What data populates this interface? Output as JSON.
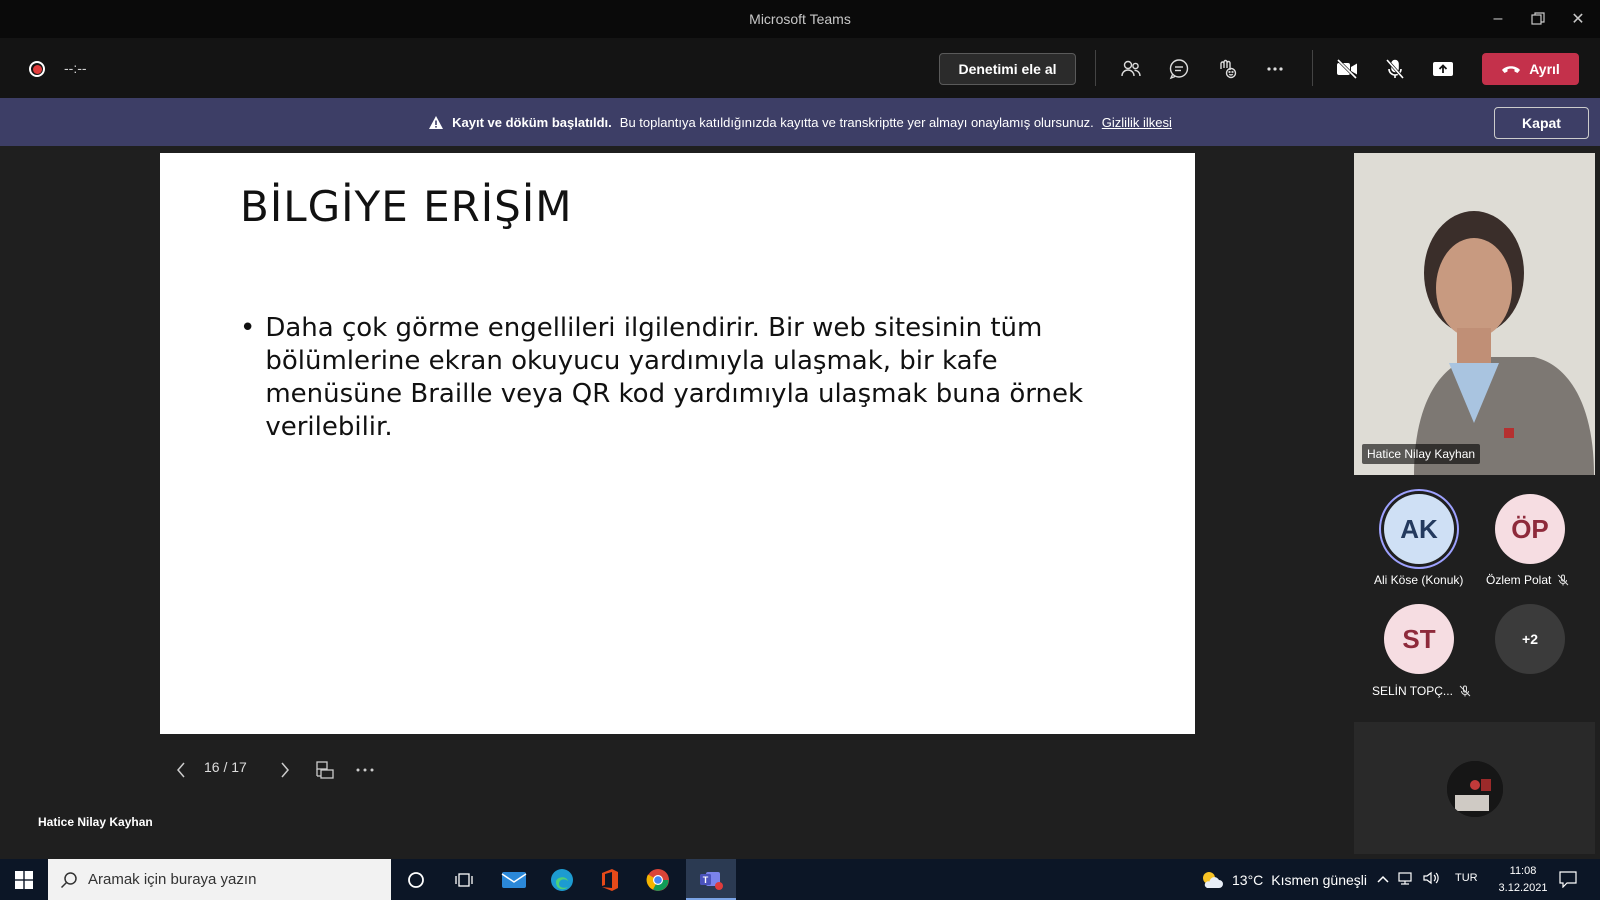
{
  "window": {
    "title": "Microsoft Teams"
  },
  "toolbar": {
    "timer": "--:--",
    "take_control_label": "Denetimi ele al",
    "leave_label": "Ayrıl"
  },
  "banner": {
    "bold_text": "Kayıt ve döküm başlatıldı.",
    "message": "Bu toplantıya katıldığınızda kayıtta ve transkriptte yer almayı onaylamış olursunuz.",
    "link_text": "Gizlilik ilkesi",
    "close_label": "Kapat"
  },
  "slide": {
    "title": "BİLGİYE ERİŞİM",
    "bullet": "Daha çok görme engellileri ilgilendirir. Bir web sitesinin tüm bölümlerine ekran okuyucu yardımıyla ulaşmak, bir kafe menüsüne Braille veya QR kod yardımıyla ulaşmak buna örnek verilebilir."
  },
  "presentation": {
    "page_counter": "16 / 17",
    "presenter_name": "Hatice Nilay Kayhan"
  },
  "participants": {
    "video_name": "Hatice Nilay Kayhan",
    "list": [
      {
        "initials": "AK",
        "name": "Ali Köse (Konuk)",
        "bg": "#cfe0f5",
        "fg": "#243a5e",
        "muted": false
      },
      {
        "initials": "ÖP",
        "name": "Özlem Polat",
        "bg": "#f6dde2",
        "fg": "#8e2a3b",
        "muted": true
      },
      {
        "initials": "ST",
        "name": "SELİN TOPÇ...",
        "bg": "#f6dde2",
        "fg": "#8e2a3b",
        "muted": true
      }
    ],
    "more_label": "+2"
  },
  "taskbar": {
    "search_placeholder": "Aramak için buraya yazın",
    "weather_temp": "13°C",
    "weather_desc": "Kısmen güneşli",
    "language": "TUR",
    "time": "11:08",
    "date": "3.12.2021"
  },
  "colors": {
    "leave": "#c4314b",
    "banner": "#3d3e66",
    "taskbar": "#0c1626"
  }
}
